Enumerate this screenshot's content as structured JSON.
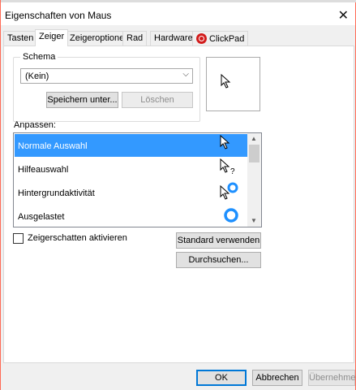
{
  "window": {
    "title": "Eigenschaften von Maus",
    "close_symbol": "✕"
  },
  "tabs": [
    {
      "label": "Tasten",
      "active": false
    },
    {
      "label": "Zeiger",
      "active": true
    },
    {
      "label": "Zeigeroptionen",
      "active": false
    },
    {
      "label": "Rad",
      "active": false
    },
    {
      "label": "Hardware",
      "active": false
    },
    {
      "label": "ClickPad",
      "active": false,
      "icon": "clickpad-icon"
    }
  ],
  "schema": {
    "legend": "Schema",
    "selected": "(Kein)",
    "save_label": "Speichern unter...",
    "delete_label": "Löschen"
  },
  "customize": {
    "label": "Anpassen:",
    "items": [
      {
        "label": "Normale Auswahl",
        "icon": "arrow-cursor-icon",
        "selected": true
      },
      {
        "label": "Hilfeauswahl",
        "icon": "help-cursor-icon",
        "selected": false
      },
      {
        "label": "Hintergrundaktivität",
        "icon": "working-in-background-cursor-icon",
        "selected": false
      },
      {
        "label": "Ausgelastet",
        "icon": "busy-cursor-icon",
        "selected": false
      }
    ]
  },
  "shadow_checkbox": {
    "label": "Zeigerschatten aktivieren",
    "checked": false
  },
  "buttons": {
    "use_default": "Standard verwenden",
    "browse": "Durchsuchen...",
    "ok": "OK",
    "cancel": "Abbrechen",
    "apply": "Übernehmen"
  },
  "colors": {
    "selection": "#3399ff",
    "busy_ring": "#1e90ff",
    "clickpad": "#d21b1b"
  }
}
